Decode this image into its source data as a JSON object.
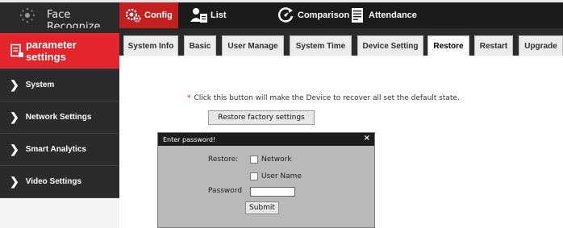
{
  "colors": {
    "accent": "#e2262b",
    "nav_active": "#c61f1f",
    "dark": "#1b1b1b"
  },
  "brand": {
    "title": "Face Recognize",
    "icon": "face-recognize-logo"
  },
  "topnav": {
    "items": [
      {
        "label": "Config",
        "icon": "config-icon"
      },
      {
        "label": "List",
        "icon": "list-icon"
      },
      {
        "label": "Comparison",
        "icon": "comparison-icon"
      },
      {
        "label": "Attendance",
        "icon": "attendance-icon"
      }
    ]
  },
  "sidebar": {
    "header": "parameter settings",
    "items": [
      {
        "label": "System"
      },
      {
        "label": "Network Settings"
      },
      {
        "label": "Smart Analytics"
      },
      {
        "label": "Video Settings"
      }
    ]
  },
  "tabs": [
    {
      "label": "System Info"
    },
    {
      "label": "Basic"
    },
    {
      "label": "User Manage"
    },
    {
      "label": "System Time"
    },
    {
      "label": "Device Setting"
    },
    {
      "label": "Restore",
      "active": true
    },
    {
      "label": "Restart"
    },
    {
      "label": "Upgrade"
    }
  ],
  "content": {
    "star": "*",
    "notice": "Click this button will make the Device to recover all set the default state.",
    "restore_button": "Restore factory settings"
  },
  "dialog": {
    "title": "Enter password!",
    "close": "×",
    "restore_label": "Restore:",
    "option_network": "Network",
    "option_username": "User Name",
    "password_label": "Password",
    "password_value": "",
    "submit": "Submit"
  }
}
